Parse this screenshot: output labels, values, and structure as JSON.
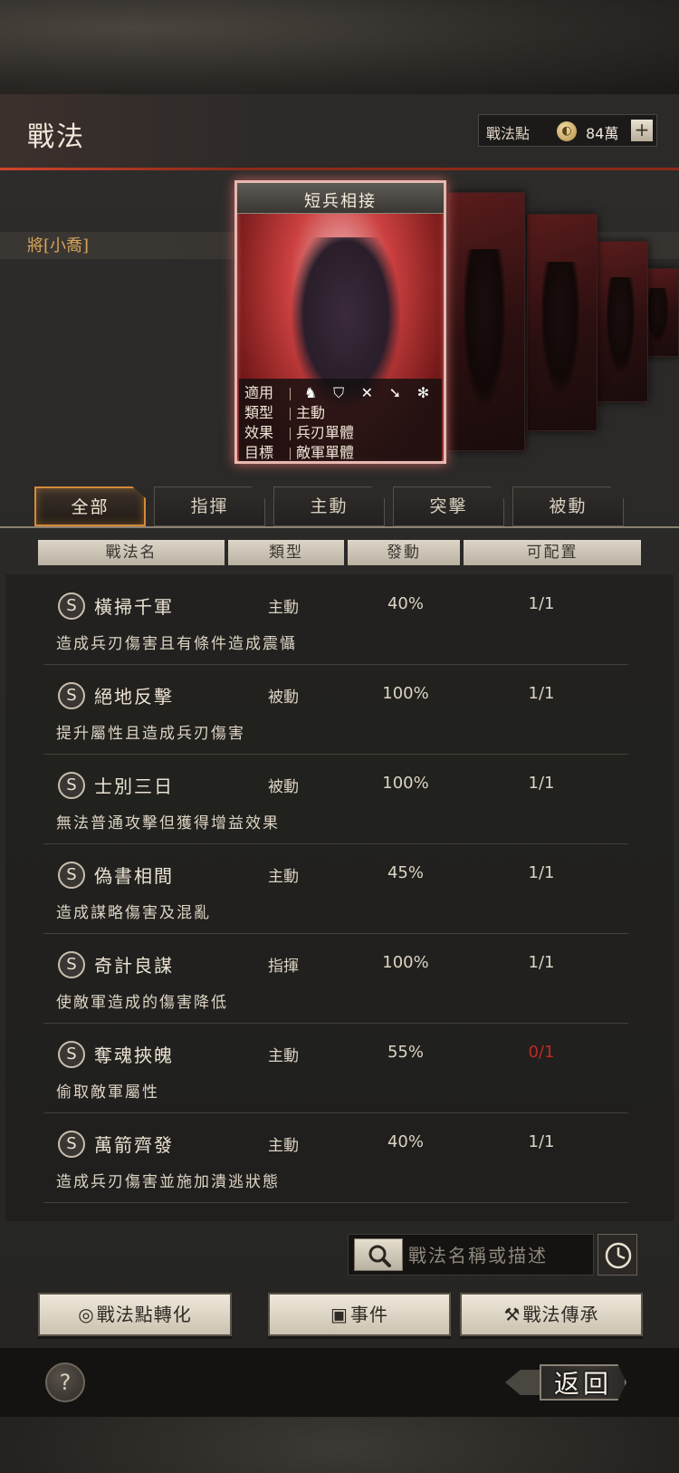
{
  "header": {
    "title": "戰法",
    "points_label": "戰法點",
    "points_value": "84萬",
    "plus_icon": "plus-icon"
  },
  "general": {
    "name": "將[小喬]"
  },
  "card": {
    "title": "短兵相接",
    "applicable_label": "適用",
    "type_label": "類型",
    "type_value": "主動",
    "effect_label": "效果",
    "effect_value": "兵刃單體",
    "target_label": "目標",
    "target_value": "敵軍單體",
    "unit_icons": [
      "cavalry-icon",
      "shield-icon",
      "bow-icon",
      "spear-icon",
      "chariot-icon"
    ]
  },
  "tabs": [
    {
      "label": "全部",
      "active": true
    },
    {
      "label": "指揮",
      "active": false
    },
    {
      "label": "主動",
      "active": false
    },
    {
      "label": "突擊",
      "active": false
    },
    {
      "label": "被動",
      "active": false
    }
  ],
  "table_headers": [
    "戰法名",
    "類型",
    "發動",
    "可配置"
  ],
  "tactics": [
    {
      "grade": "S",
      "name": "橫掃千軍",
      "type": "主動",
      "rate": "40%",
      "config": "1/1",
      "desc": "造成兵刃傷害且有條件造成震懾"
    },
    {
      "grade": "S",
      "name": "絕地反擊",
      "type": "被動",
      "rate": "100%",
      "config": "1/1",
      "desc": "提升屬性且造成兵刃傷害"
    },
    {
      "grade": "S",
      "name": "士別三日",
      "type": "被動",
      "rate": "100%",
      "config": "1/1",
      "desc": "無法普通攻擊但獲得增益效果"
    },
    {
      "grade": "S",
      "name": "偽書相間",
      "type": "主動",
      "rate": "45%",
      "config": "1/1",
      "desc": "造成謀略傷害及混亂"
    },
    {
      "grade": "S",
      "name": "奇計良謀",
      "type": "指揮",
      "rate": "100%",
      "config": "1/1",
      "desc": "使敵軍造成的傷害降低"
    },
    {
      "grade": "S",
      "name": "奪魂挾魄",
      "type": "主動",
      "rate": "55%",
      "config": "0/1",
      "desc": "偷取敵軍屬性"
    },
    {
      "grade": "S",
      "name": "萬箭齊發",
      "type": "主動",
      "rate": "40%",
      "config": "1/1",
      "desc": "造成兵刃傷害並施加潰逃狀態"
    }
  ],
  "search": {
    "placeholder": "戰法名稱或描述"
  },
  "actions": {
    "convert_label": "戰法點轉化",
    "event_label": "事件",
    "inherit_label": "戰法傳承"
  },
  "footer": {
    "help_label": "?",
    "back_label": "返回"
  },
  "colors": {
    "accent_red": "#c02a22",
    "tab_active": "#d48a3a"
  }
}
